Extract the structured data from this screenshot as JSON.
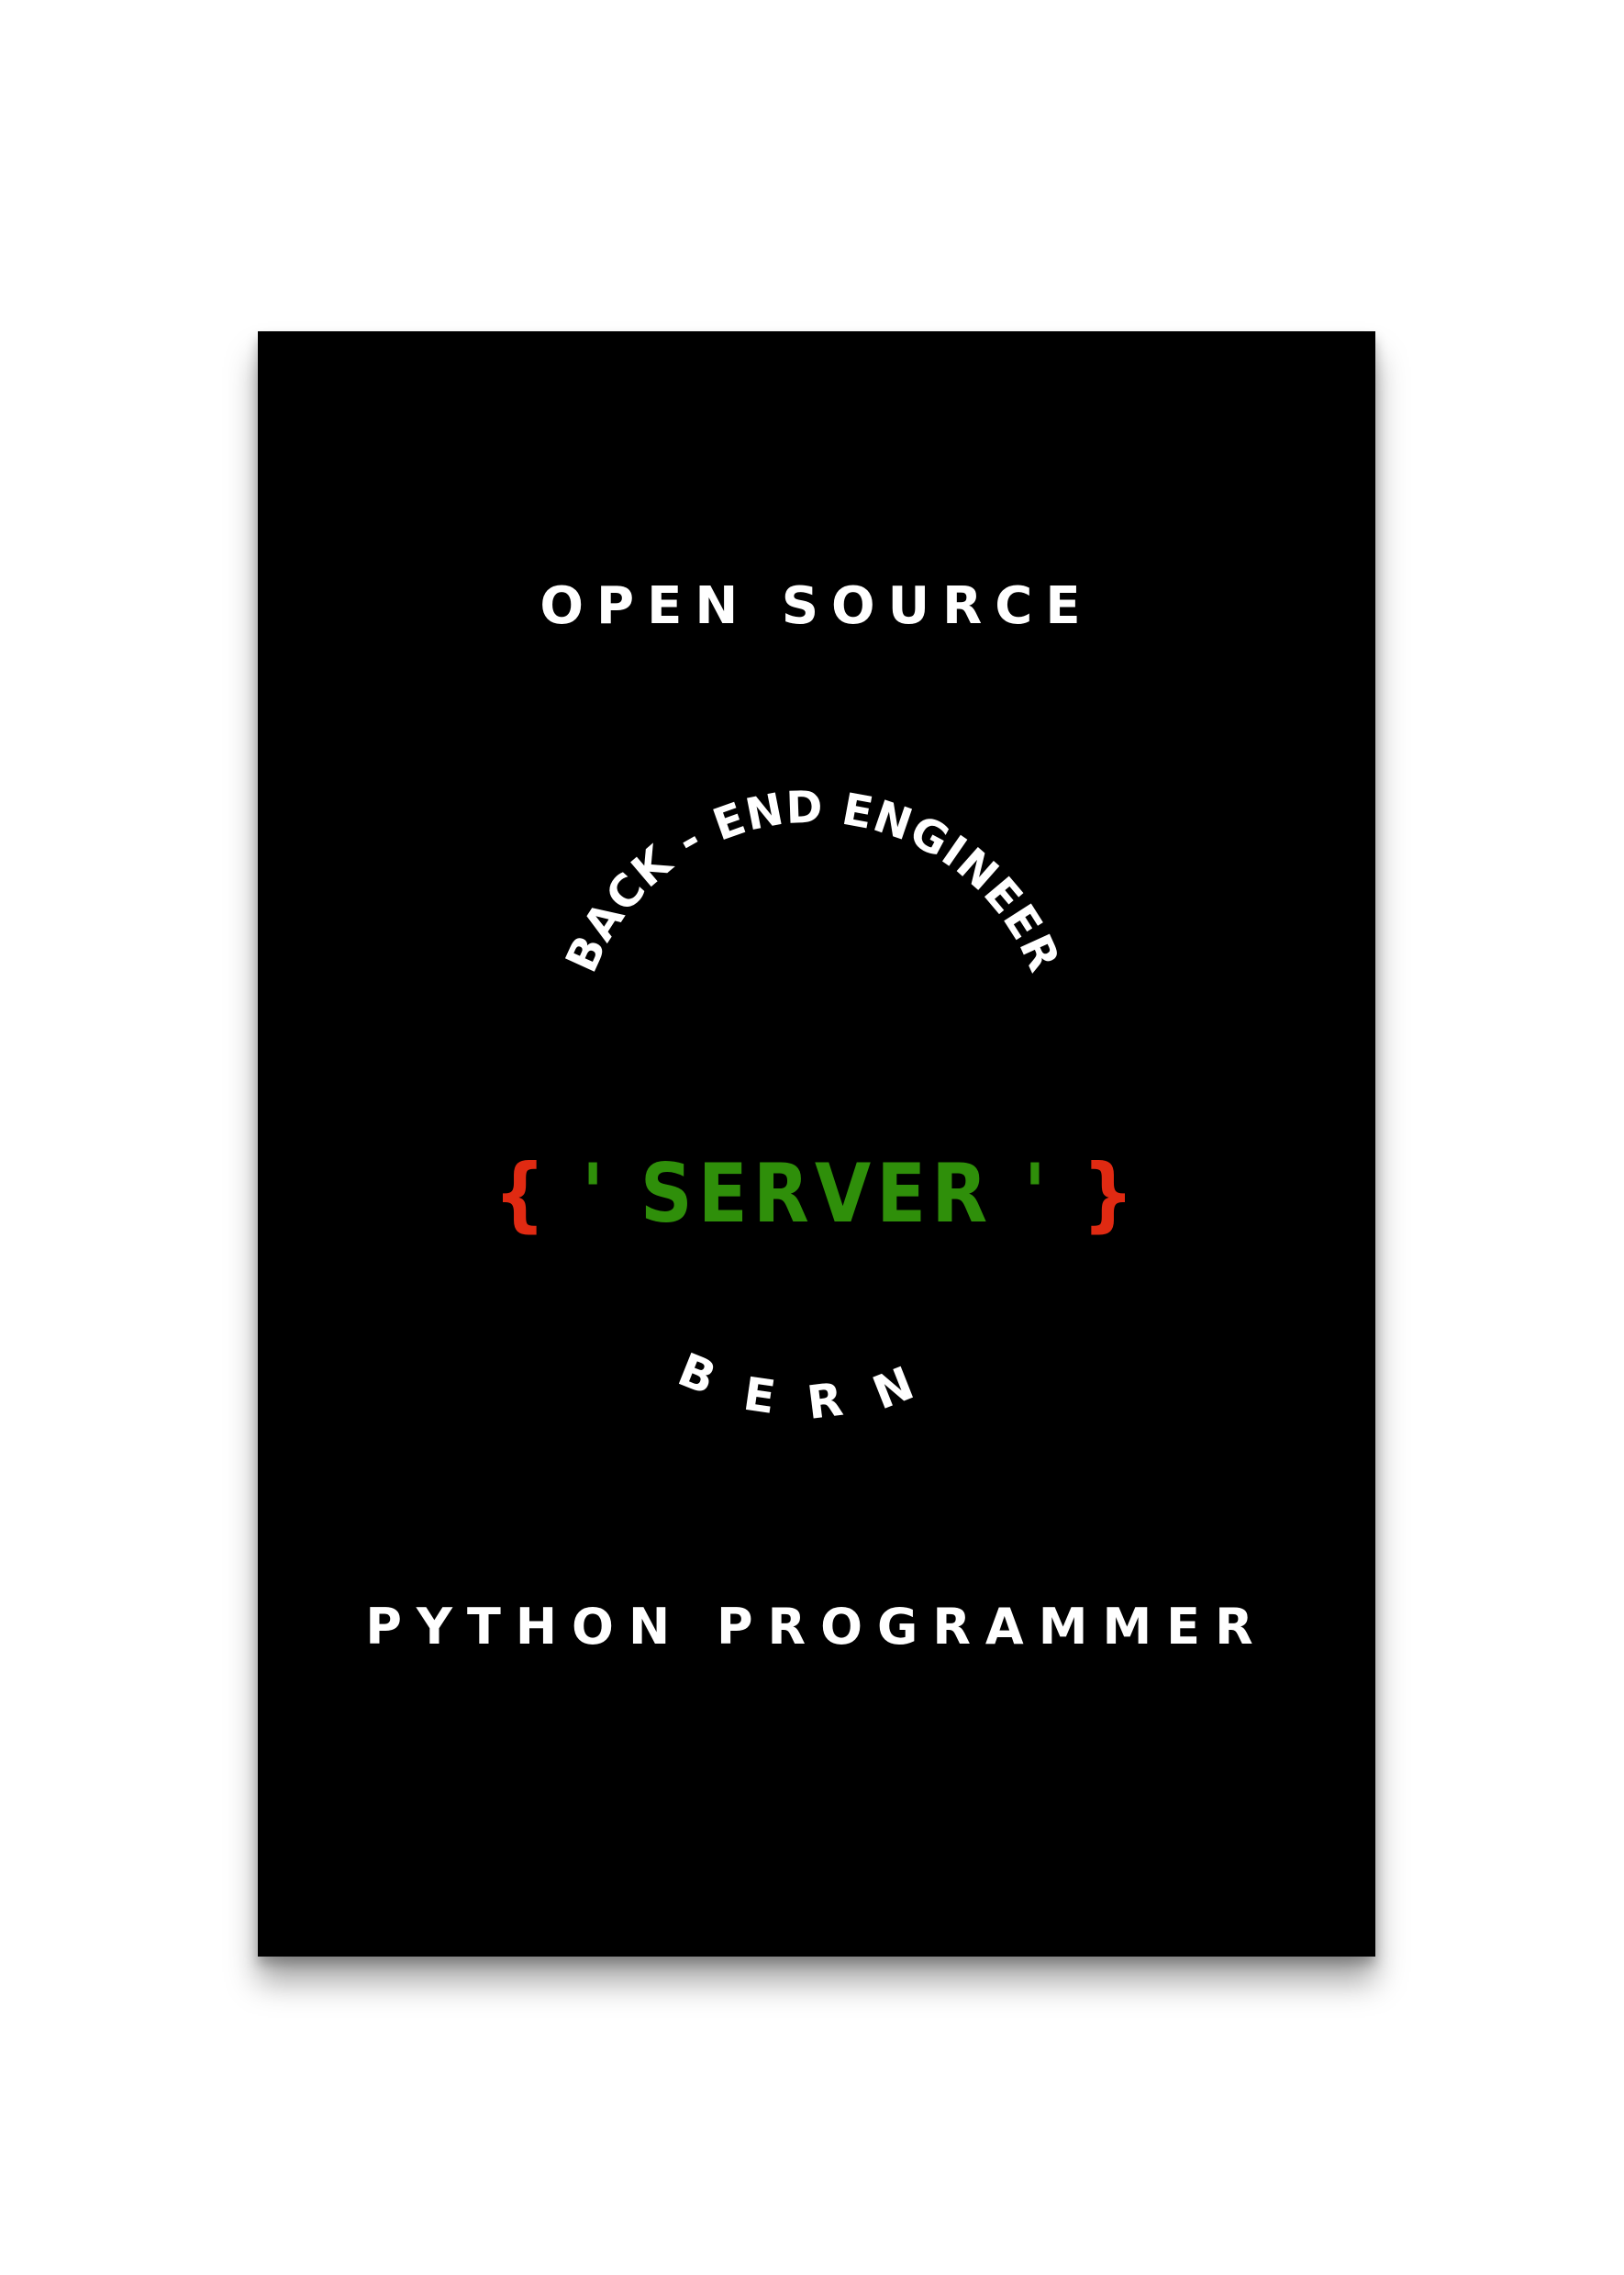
{
  "poster": {
    "line_top": "OPEN SOURCE",
    "arc_top": "BACK - END ENGINEER",
    "center": {
      "open_brace": "{",
      "open_quote": "'",
      "word": "SERVER",
      "close_quote": "'",
      "close_brace": "}"
    },
    "arc_bottom": "BERN",
    "line_bottom": "PYTHON PROGRAMMER"
  },
  "colors": {
    "background": "#ffffff",
    "poster": "#000000",
    "text": "#ffffff",
    "accent_green": "#2f8f0a",
    "accent_red": "#e02a12"
  }
}
